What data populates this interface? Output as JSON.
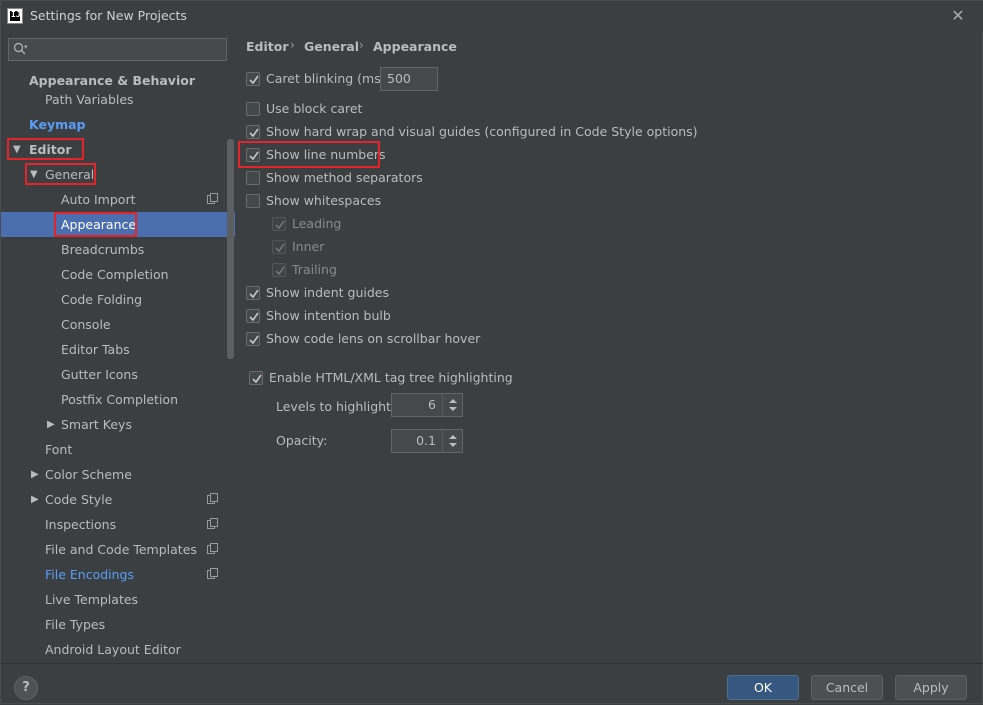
{
  "window": {
    "title": "Settings for New Projects",
    "app_icon_text": "IJ"
  },
  "search": {
    "placeholder": ""
  },
  "sidebar": {
    "items": [
      {
        "label": "Appearance & Behavior"
      },
      {
        "label": "Path Variables"
      },
      {
        "label": "Keymap"
      },
      {
        "label": "Editor"
      },
      {
        "label": "General"
      },
      {
        "label": "Auto Import"
      },
      {
        "label": "Appearance"
      },
      {
        "label": "Breadcrumbs"
      },
      {
        "label": "Code Completion"
      },
      {
        "label": "Code Folding"
      },
      {
        "label": "Console"
      },
      {
        "label": "Editor Tabs"
      },
      {
        "label": "Gutter Icons"
      },
      {
        "label": "Postfix Completion"
      },
      {
        "label": "Smart Keys"
      },
      {
        "label": "Font"
      },
      {
        "label": "Color Scheme"
      },
      {
        "label": "Code Style"
      },
      {
        "label": "Inspections"
      },
      {
        "label": "File and Code Templates"
      },
      {
        "label": "File Encodings"
      },
      {
        "label": "Live Templates"
      },
      {
        "label": "File Types"
      },
      {
        "label": "Android Layout Editor"
      }
    ]
  },
  "breadcrumb": [
    "Editor",
    "General",
    "Appearance"
  ],
  "options": {
    "caret_blinking": {
      "label": "Caret blinking (ms):",
      "checked": true,
      "value": "500"
    },
    "use_block_caret": {
      "label": "Use block caret",
      "checked": false
    },
    "hard_wrap": {
      "label": "Show hard wrap and visual guides (configured in Code Style options)",
      "checked": true
    },
    "line_numbers": {
      "label": "Show line numbers",
      "checked": true
    },
    "method_separators": {
      "label": "Show method separators",
      "checked": false
    },
    "whitespaces": {
      "label": "Show whitespaces",
      "checked": false
    },
    "leading": {
      "label": "Leading",
      "checked": true
    },
    "inner": {
      "label": "Inner",
      "checked": true
    },
    "trailing": {
      "label": "Trailing",
      "checked": true
    },
    "indent_guides": {
      "label": "Show indent guides",
      "checked": true
    },
    "intention_bulb": {
      "label": "Show intention bulb",
      "checked": true
    },
    "code_lens": {
      "label": "Show code lens on scrollbar hover",
      "checked": true
    },
    "tag_tree": {
      "label": "Enable HTML/XML tag tree highlighting",
      "checked": true
    },
    "levels": {
      "label": "Levels to highlight:",
      "value": "6"
    },
    "opacity": {
      "label": "Opacity:",
      "value": "0.1"
    }
  },
  "buttons": {
    "help": "?",
    "ok": "OK",
    "cancel": "Cancel",
    "apply": "Apply"
  },
  "colors": {
    "background": "#3c3f41",
    "selection": "#4b6eaf",
    "link": "#589df6",
    "highlight_box": "#e3242b",
    "primary_button": "#365880"
  }
}
